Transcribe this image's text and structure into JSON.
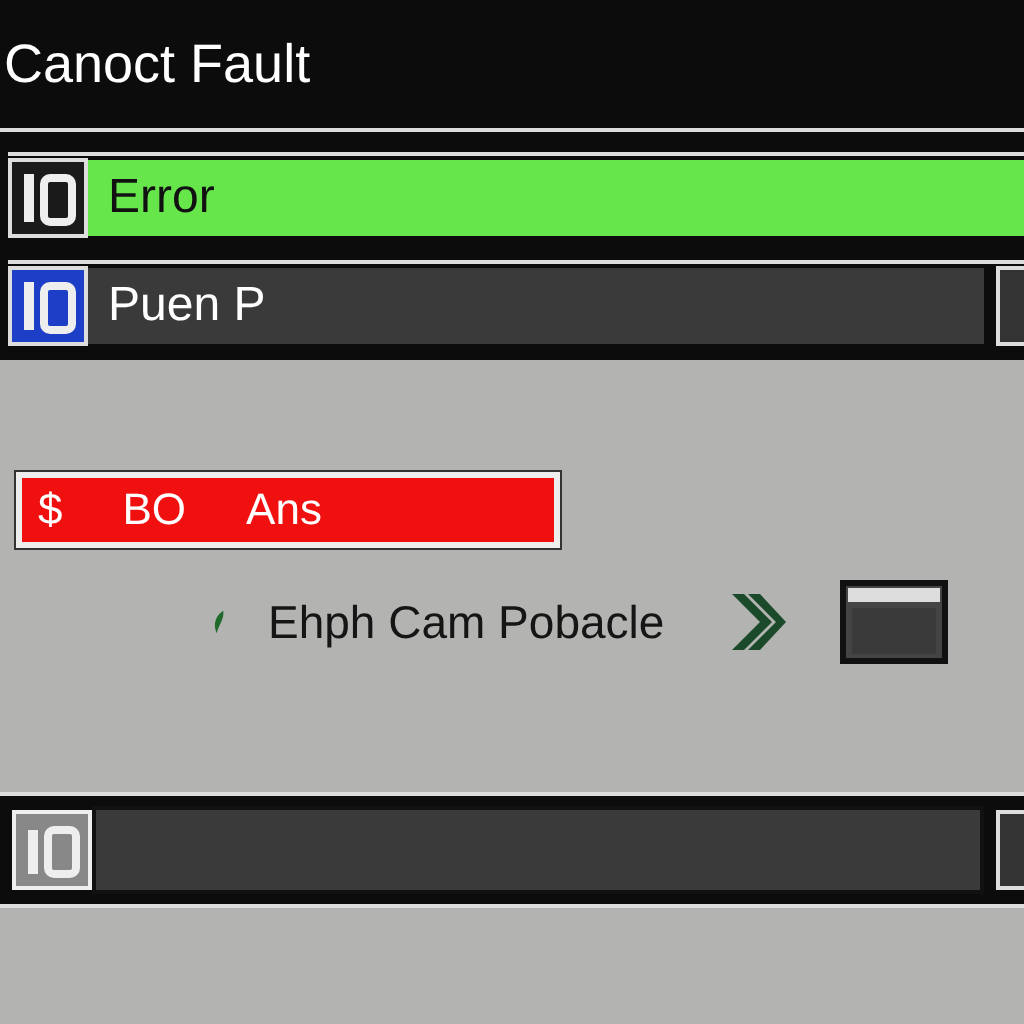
{
  "window": {
    "title": "Canoct Fault"
  },
  "bars": [
    {
      "label": "Error",
      "color": "#66e64a",
      "selected": false
    },
    {
      "label": "Puen P",
      "color": "#3a3a3a",
      "selected": true
    }
  ],
  "alert": {
    "texts": [
      "$",
      "BO",
      "Ans"
    ],
    "color": "#f01010"
  },
  "status": {
    "text": "Ehph Cam Pobacle"
  }
}
